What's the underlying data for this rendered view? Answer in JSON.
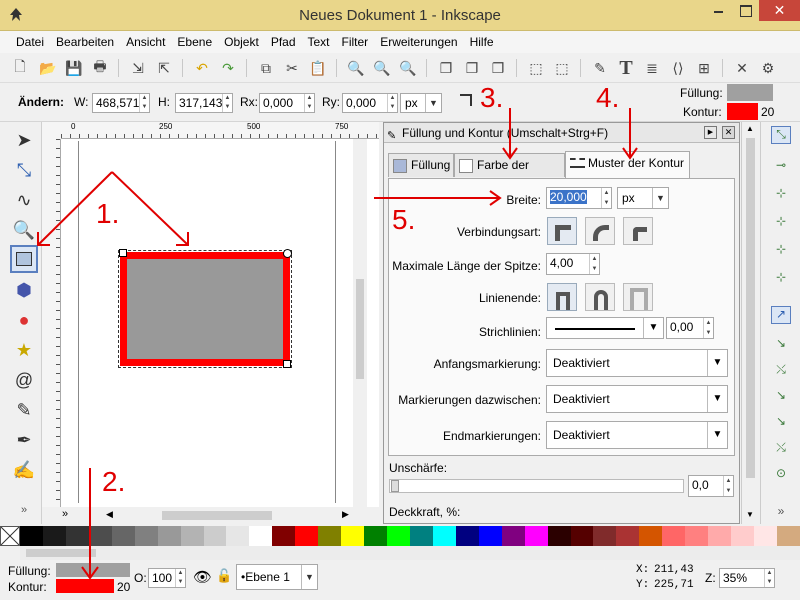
{
  "window": {
    "title": "Neues Dokument 1 - Inkscape",
    "close_glyph": "✕"
  },
  "menu": [
    "Datei",
    "Bearbeiten",
    "Ansicht",
    "Ebene",
    "Objekt",
    "Pfad",
    "Text",
    "Filter",
    "Erweiterungen",
    "Hilfe"
  ],
  "tool_controls": {
    "mode_label": "Ändern:",
    "w_label": "W:",
    "w_value": "468,571",
    "h_label": "H:",
    "h_value": "317,143",
    "rx_label": "Rx:",
    "rx_value": "0,000",
    "ry_label": "Ry:",
    "ry_value": "0,000",
    "unit": "px"
  },
  "style_indicator_top": {
    "fill_label": "Füllung:",
    "stroke_label": "Kontur:",
    "stroke_width": "20",
    "fill_color": "#a0a0a0",
    "stroke_color": "#ff0000"
  },
  "ruler": {
    "marks": [
      "0",
      "250",
      "500",
      "750"
    ]
  },
  "dialog": {
    "title": "Füllung und Kontur (Umschalt+Strg+F)",
    "tabs": [
      "Füllung",
      "Farbe der Kontur",
      "Muster der Kontur"
    ],
    "width_label": "Breite:",
    "width_value": "20,000",
    "width_unit": "px",
    "join_label": "Verbindungsart:",
    "miter_label": "Maximale Länge der Spitze:",
    "miter_value": "4,00",
    "cap_label": "Linienende:",
    "dash_label": "Strichlinien:",
    "dash_offset": "0,00",
    "start_marker_label": "Anfangsmarkierung:",
    "start_marker_value": "Deaktiviert",
    "mid_marker_label": "Markierungen dazwischen:",
    "mid_marker_value": "Deaktiviert",
    "end_marker_label": "Endmarkierungen:",
    "end_marker_value": "Deaktiviert",
    "blur_label": "Unschärfe:",
    "blur_value": "0,0",
    "opacity_label": "Deckkraft, %:"
  },
  "palette": [
    "#000000",
    "#1a1a1a",
    "#333333",
    "#4d4d4d",
    "#666666",
    "#808080",
    "#999999",
    "#b3b3b3",
    "#cccccc",
    "#e6e6e6",
    "#ffffff",
    "#800000",
    "#ff0000",
    "#808000",
    "#ffff00",
    "#008000",
    "#00ff00",
    "#008080",
    "#00ffff",
    "#000080",
    "#0000ff",
    "#800080",
    "#ff00ff",
    "#2b0000",
    "#550000",
    "#802b2b",
    "#aa3333",
    "#d45500",
    "#ff6666",
    "#ff8080",
    "#ffaaaa",
    "#ffcccc",
    "#ffe6e6",
    "#d4aa7f"
  ],
  "status": {
    "fill_label": "Füllung:",
    "stroke_label": "Kontur:",
    "stroke_width": "20",
    "opacity_label": "O:",
    "opacity_value": "100",
    "layer": "•Ebene 1",
    "x_label": "X:",
    "x_value": "211,43",
    "y_label": "Y:",
    "y_value": "225,71",
    "zoom_label": "Z:",
    "zoom_value": "35%"
  },
  "annotations": [
    "1.",
    "2.",
    "3.",
    "4.",
    "5."
  ]
}
